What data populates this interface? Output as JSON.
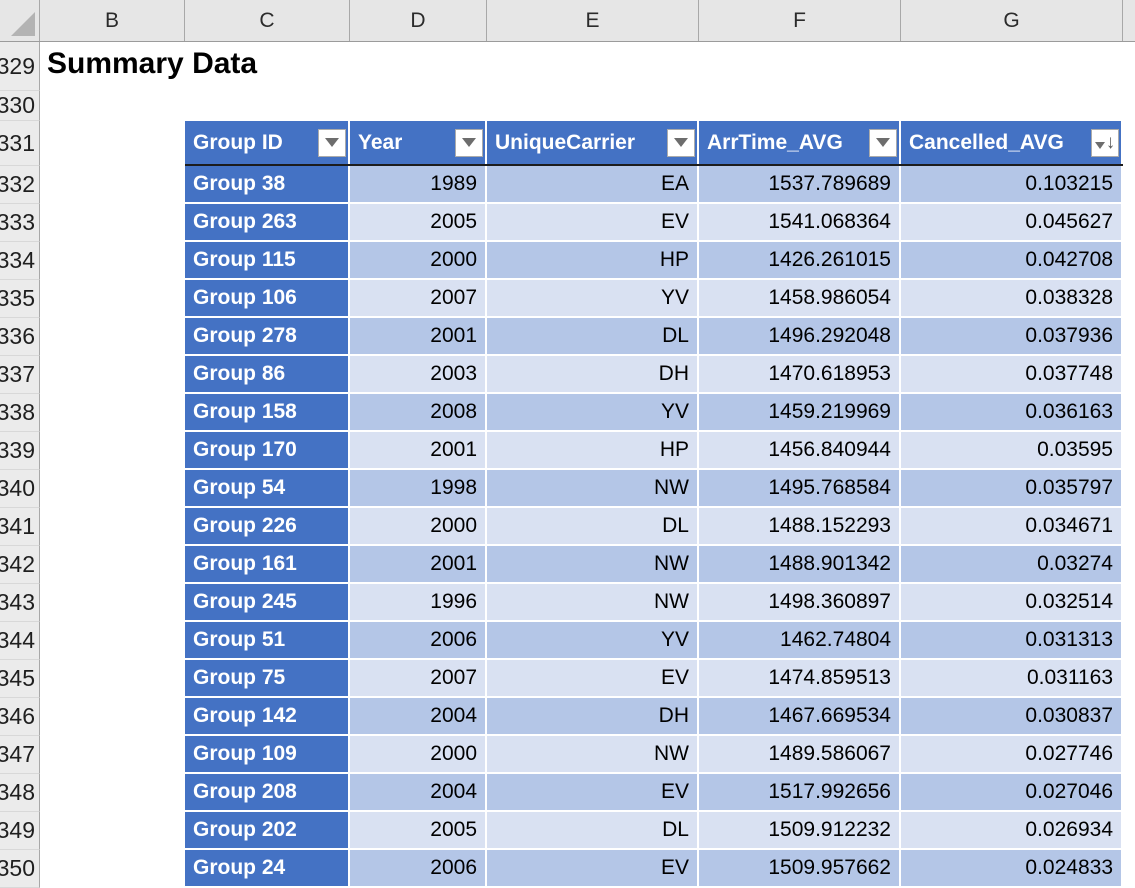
{
  "sheet": {
    "title": "Summary Data",
    "column_letters": [
      "B",
      "C",
      "D",
      "E",
      "F",
      "G"
    ],
    "row_numbers": [
      "329",
      "330",
      "331",
      "332",
      "333",
      "334",
      "335",
      "336",
      "337",
      "338",
      "339",
      "340",
      "341",
      "342",
      "343",
      "344",
      "345",
      "346",
      "347",
      "348",
      "349",
      "350"
    ]
  },
  "table": {
    "headers": [
      {
        "label": "Group ID",
        "icon": "filter-dropdown-icon"
      },
      {
        "label": "Year",
        "icon": "filter-dropdown-icon"
      },
      {
        "label": "UniqueCarrier",
        "icon": "filter-dropdown-icon"
      },
      {
        "label": "ArrTime_AVG",
        "icon": "filter-dropdown-icon"
      },
      {
        "label": "Cancelled_AVG",
        "icon": "filter-sort-descending-icon"
      }
    ],
    "rows": [
      [
        "Group 38",
        "1989",
        "EA",
        "1537.789689",
        "0.103215"
      ],
      [
        "Group 263",
        "2005",
        "EV",
        "1541.068364",
        "0.045627"
      ],
      [
        "Group 115",
        "2000",
        "HP",
        "1426.261015",
        "0.042708"
      ],
      [
        "Group 106",
        "2007",
        "YV",
        "1458.986054",
        "0.038328"
      ],
      [
        "Group 278",
        "2001",
        "DL",
        "1496.292048",
        "0.037936"
      ],
      [
        "Group 86",
        "2003",
        "DH",
        "1470.618953",
        "0.037748"
      ],
      [
        "Group 158",
        "2008",
        "YV",
        "1459.219969",
        "0.036163"
      ],
      [
        "Group 170",
        "2001",
        "HP",
        "1456.840944",
        "0.03595"
      ],
      [
        "Group 54",
        "1998",
        "NW",
        "1495.768584",
        "0.035797"
      ],
      [
        "Group 226",
        "2000",
        "DL",
        "1488.152293",
        "0.034671"
      ],
      [
        "Group 161",
        "2001",
        "NW",
        "1488.901342",
        "0.03274"
      ],
      [
        "Group 245",
        "1996",
        "NW",
        "1498.360897",
        "0.032514"
      ],
      [
        "Group 51",
        "2006",
        "YV",
        "1462.74804",
        "0.031313"
      ],
      [
        "Group 75",
        "2007",
        "EV",
        "1474.859513",
        "0.031163"
      ],
      [
        "Group 142",
        "2004",
        "DH",
        "1467.669534",
        "0.030837"
      ],
      [
        "Group 109",
        "2000",
        "NW",
        "1489.586067",
        "0.027746"
      ],
      [
        "Group 208",
        "2004",
        "EV",
        "1517.992656",
        "0.027046"
      ],
      [
        "Group 202",
        "2005",
        "DL",
        "1509.912232",
        "0.026934"
      ],
      [
        "Group 24",
        "2006",
        "EV",
        "1509.957662",
        "0.024833"
      ]
    ]
  },
  "colors": {
    "header_blue": "#4472C4",
    "band_dark": "#B4C6E7",
    "band_light": "#D9E1F2",
    "column_strip_bg": "#E6E6E6"
  }
}
